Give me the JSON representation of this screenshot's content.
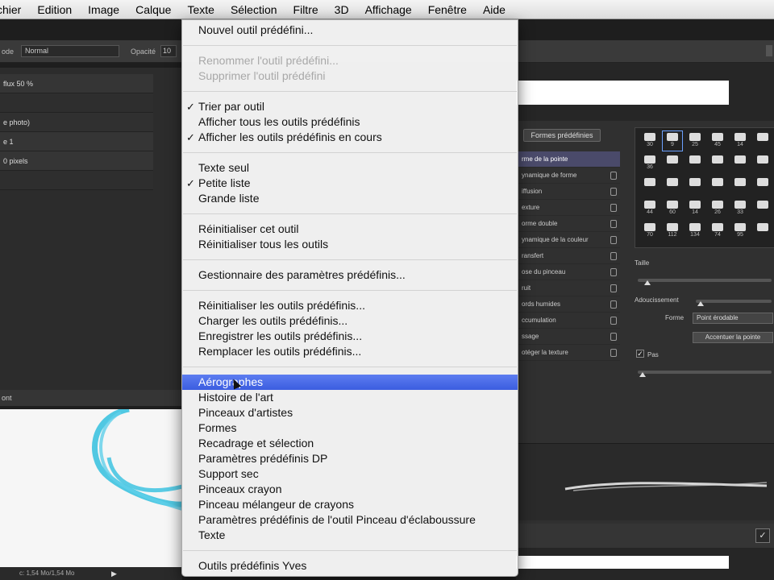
{
  "menubar": {
    "items": [
      "chier",
      "Edition",
      "Image",
      "Calque",
      "Texte",
      "Sélection",
      "Filtre",
      "3D",
      "Affichage",
      "Fenêtre",
      "Aide"
    ]
  },
  "options_bar": {
    "mode_label": "ode",
    "mode_value": "Normal",
    "opacity_label": "Opacité",
    "opacity_value": "10"
  },
  "tool_presets": {
    "rows": [
      "flux 50 %",
      "",
      "e photo)",
      "e 1",
      "0 pixels",
      ""
    ],
    "footer": "ont"
  },
  "status_bar": {
    "text": "c: 1,54 Mo/1,54 Mo",
    "arrow": "▶"
  },
  "menu": {
    "groups": [
      {
        "items": [
          {
            "label": "Nouvel outil prédéfini...",
            "disabled": false
          }
        ]
      },
      {
        "items": [
          {
            "label": "Renommer l'outil prédéfini...",
            "disabled": true
          },
          {
            "label": "Supprimer l'outil prédéfini",
            "disabled": true
          }
        ]
      },
      {
        "items": [
          {
            "label": "Trier par outil",
            "checked": true
          },
          {
            "label": "Afficher tous les outils prédéfinis"
          },
          {
            "label": "Afficher les outils prédéfinis en cours",
            "checked": true
          }
        ]
      },
      {
        "items": [
          {
            "label": "Texte seul"
          },
          {
            "label": "Petite liste",
            "checked": true
          },
          {
            "label": "Grande liste"
          }
        ]
      },
      {
        "items": [
          {
            "label": "Réinitialiser cet outil"
          },
          {
            "label": "Réinitialiser tous les outils"
          }
        ]
      },
      {
        "items": [
          {
            "label": "Gestionnaire des paramètres prédéfinis..."
          }
        ]
      },
      {
        "items": [
          {
            "label": "Réinitialiser les outils prédéfinis..."
          },
          {
            "label": "Charger les outils prédéfinis..."
          },
          {
            "label": "Enregistrer les outils prédéfinis..."
          },
          {
            "label": "Remplacer les outils prédéfinis..."
          }
        ]
      },
      {
        "items": [
          {
            "label": "Aérographes",
            "highlighted": true
          },
          {
            "label": "Histoire de l'art"
          },
          {
            "label": "Pinceaux d'artistes"
          },
          {
            "label": "Formes"
          },
          {
            "label": "Recadrage et sélection"
          },
          {
            "label": "Paramètres prédéfinis DP"
          },
          {
            "label": "Support sec"
          },
          {
            "label": "Pinceaux crayon"
          },
          {
            "label": "Pinceau mélangeur de crayons"
          },
          {
            "label": "Paramètres prédéfinis de l'outil Pinceau d'éclaboussure"
          },
          {
            "label": "Texte"
          }
        ]
      },
      {
        "items": [
          {
            "label": "Outils prédéfinis Yves"
          }
        ]
      }
    ]
  },
  "brush_panel": {
    "preset_button": "Formes prédéfinies",
    "options": [
      "rme de la pointe",
      "ynamique de forme",
      "iffusion",
      "exture",
      "orme double",
      "ynamique de la couleur",
      "ransfert",
      "ose du pinceau",
      "ruit",
      "ords humides",
      "ccumulation",
      "ssage",
      "otéger la texture"
    ],
    "tip_sizes": [
      "30",
      "9",
      "25",
      "45",
      "14",
      "",
      "36",
      "",
      "",
      "",
      "",
      "",
      "",
      "",
      "",
      "",
      "",
      "",
      "44",
      "60",
      "14",
      "26",
      "33",
      "",
      "70",
      "112",
      "134",
      "74",
      "95",
      ""
    ],
    "size_label": "Taille",
    "smoothing_label": "Adoucissement",
    "shape_label": "Forme",
    "shape_value": "Point érodable",
    "sharpen_button": "Accentuer la pointe",
    "spacing_label": "Pas",
    "spacing_checked": "✓",
    "footer_icon": "✓"
  }
}
